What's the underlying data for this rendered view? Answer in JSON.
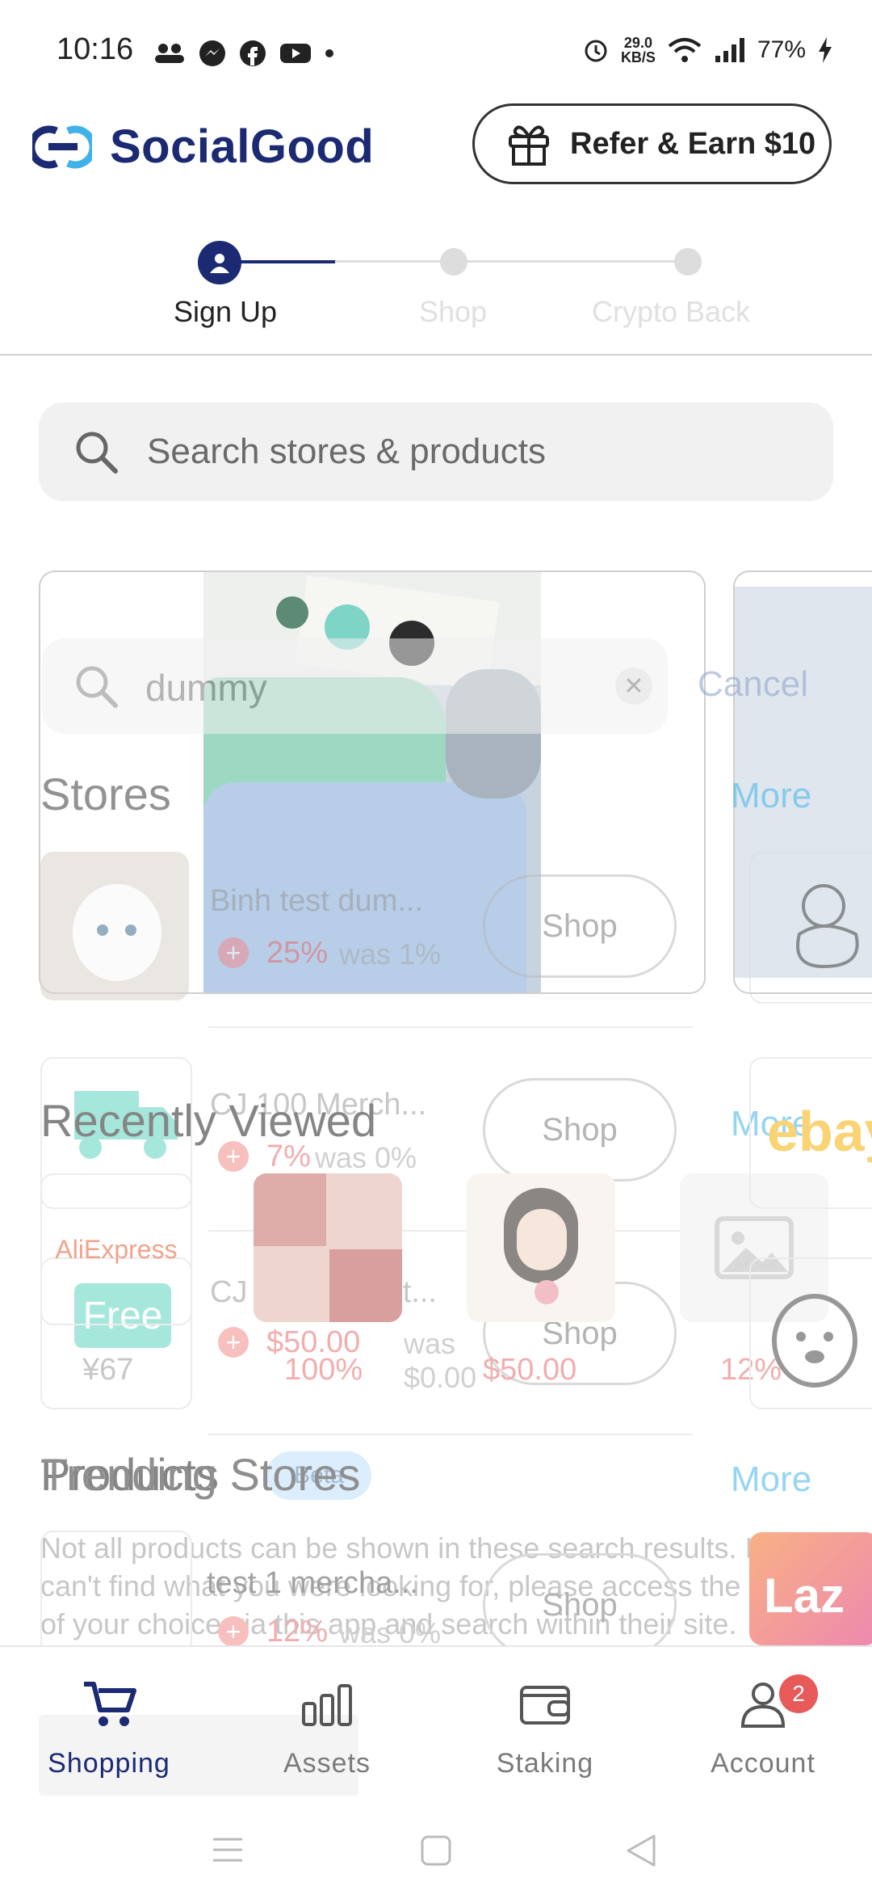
{
  "status_bar": {
    "time": "10:16",
    "network_speed_value": "29.0",
    "network_speed_unit": "KB/S",
    "battery": "77%"
  },
  "header": {
    "brand": "SocialGood",
    "refer_label": "Refer & Earn $10"
  },
  "stepper": {
    "steps": [
      "Sign Up",
      "Shop",
      "Crypto Back"
    ],
    "active_index": 0
  },
  "search": {
    "placeholder": "Search stores & products"
  },
  "overlay": {
    "search_value": "dummy",
    "cancel_label": "Cancel",
    "stores_title": "Stores",
    "more_label": "More",
    "stores": [
      {
        "name": "Binh test dum...",
        "percent": "25%",
        "was": "was 1%"
      },
      {
        "name": "CJ 100 Merch...",
        "percent": "7%",
        "was": "was 0%"
      },
      {
        "name": "CJ Eba default...",
        "percent": "$50.00",
        "was": "was $0.00"
      }
    ],
    "shop_label": "Shop",
    "recently_viewed_title": "Recently Viewed",
    "recent_badges": [
      "Free",
      "Free"
    ],
    "aliexpress_label": "AliExpress",
    "recent_prices": [
      "¥67",
      "100%",
      "$50.00",
      "12%"
    ],
    "trending_stores_title": "Trending Stores",
    "products_title": "Products",
    "products_badge": "Beta",
    "products_note": "Not all products can be shown in these search results. If you can't find what you were looking for, please access the store of your choice via this app and search within their site.",
    "product_item": {
      "name": "test 1 mercha...",
      "percent": "12%",
      "was": "was 0%"
    },
    "ebay_label": "ebay",
    "lazada_label": "Laz"
  },
  "bottom_nav": {
    "items": [
      {
        "label": "Shopping",
        "icon": "cart-icon"
      },
      {
        "label": "Assets",
        "icon": "bar-chart-icon"
      },
      {
        "label": "Staking",
        "icon": "wallet-icon"
      },
      {
        "label": "Account",
        "icon": "user-icon"
      }
    ],
    "account_badge": "2"
  },
  "colors": {
    "brand": "#1b2a72",
    "accent": "#3fb3e9",
    "danger": "#e86a6a"
  }
}
